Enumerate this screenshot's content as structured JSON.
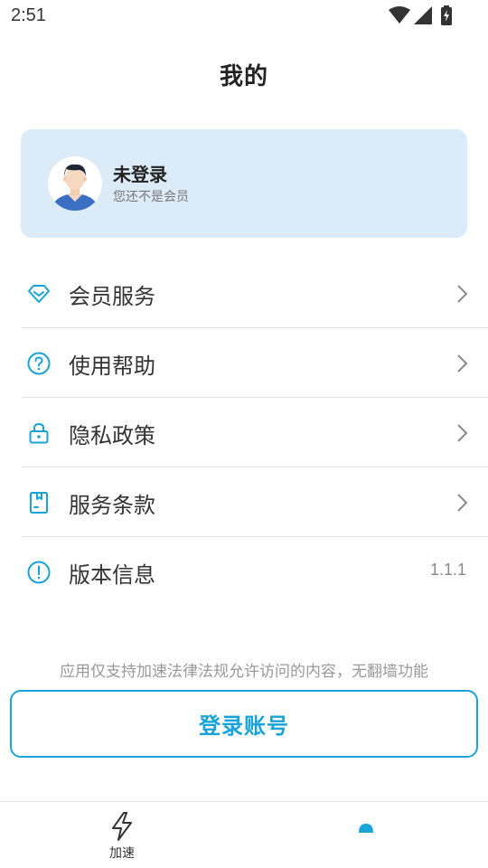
{
  "status_bar": {
    "time": "2:51"
  },
  "page": {
    "title": "我的"
  },
  "profile": {
    "name": "未登录",
    "subtitle": "您还不是会员"
  },
  "menu": [
    {
      "label": "会员服务",
      "icon": "diamond-icon"
    },
    {
      "label": "使用帮助",
      "icon": "question-circle-icon"
    },
    {
      "label": "隐私政策",
      "icon": "lock-icon"
    },
    {
      "label": "服务条款",
      "icon": "document-icon"
    },
    {
      "label": "版本信息",
      "icon": "info-circle-icon",
      "value": "1.1.1"
    }
  ],
  "disclaimer": "应用仅支持加速法律法规允许访问的内容，无翻墙功能",
  "login_button": {
    "label": "登录账号"
  },
  "bottom_nav": {
    "items": [
      {
        "label": "加速",
        "icon": "lightning-icon"
      },
      {
        "label": "",
        "icon": "profile-icon"
      }
    ]
  },
  "colors": {
    "accent": "#1aa3d9",
    "card_bg": "#dcebf8"
  }
}
